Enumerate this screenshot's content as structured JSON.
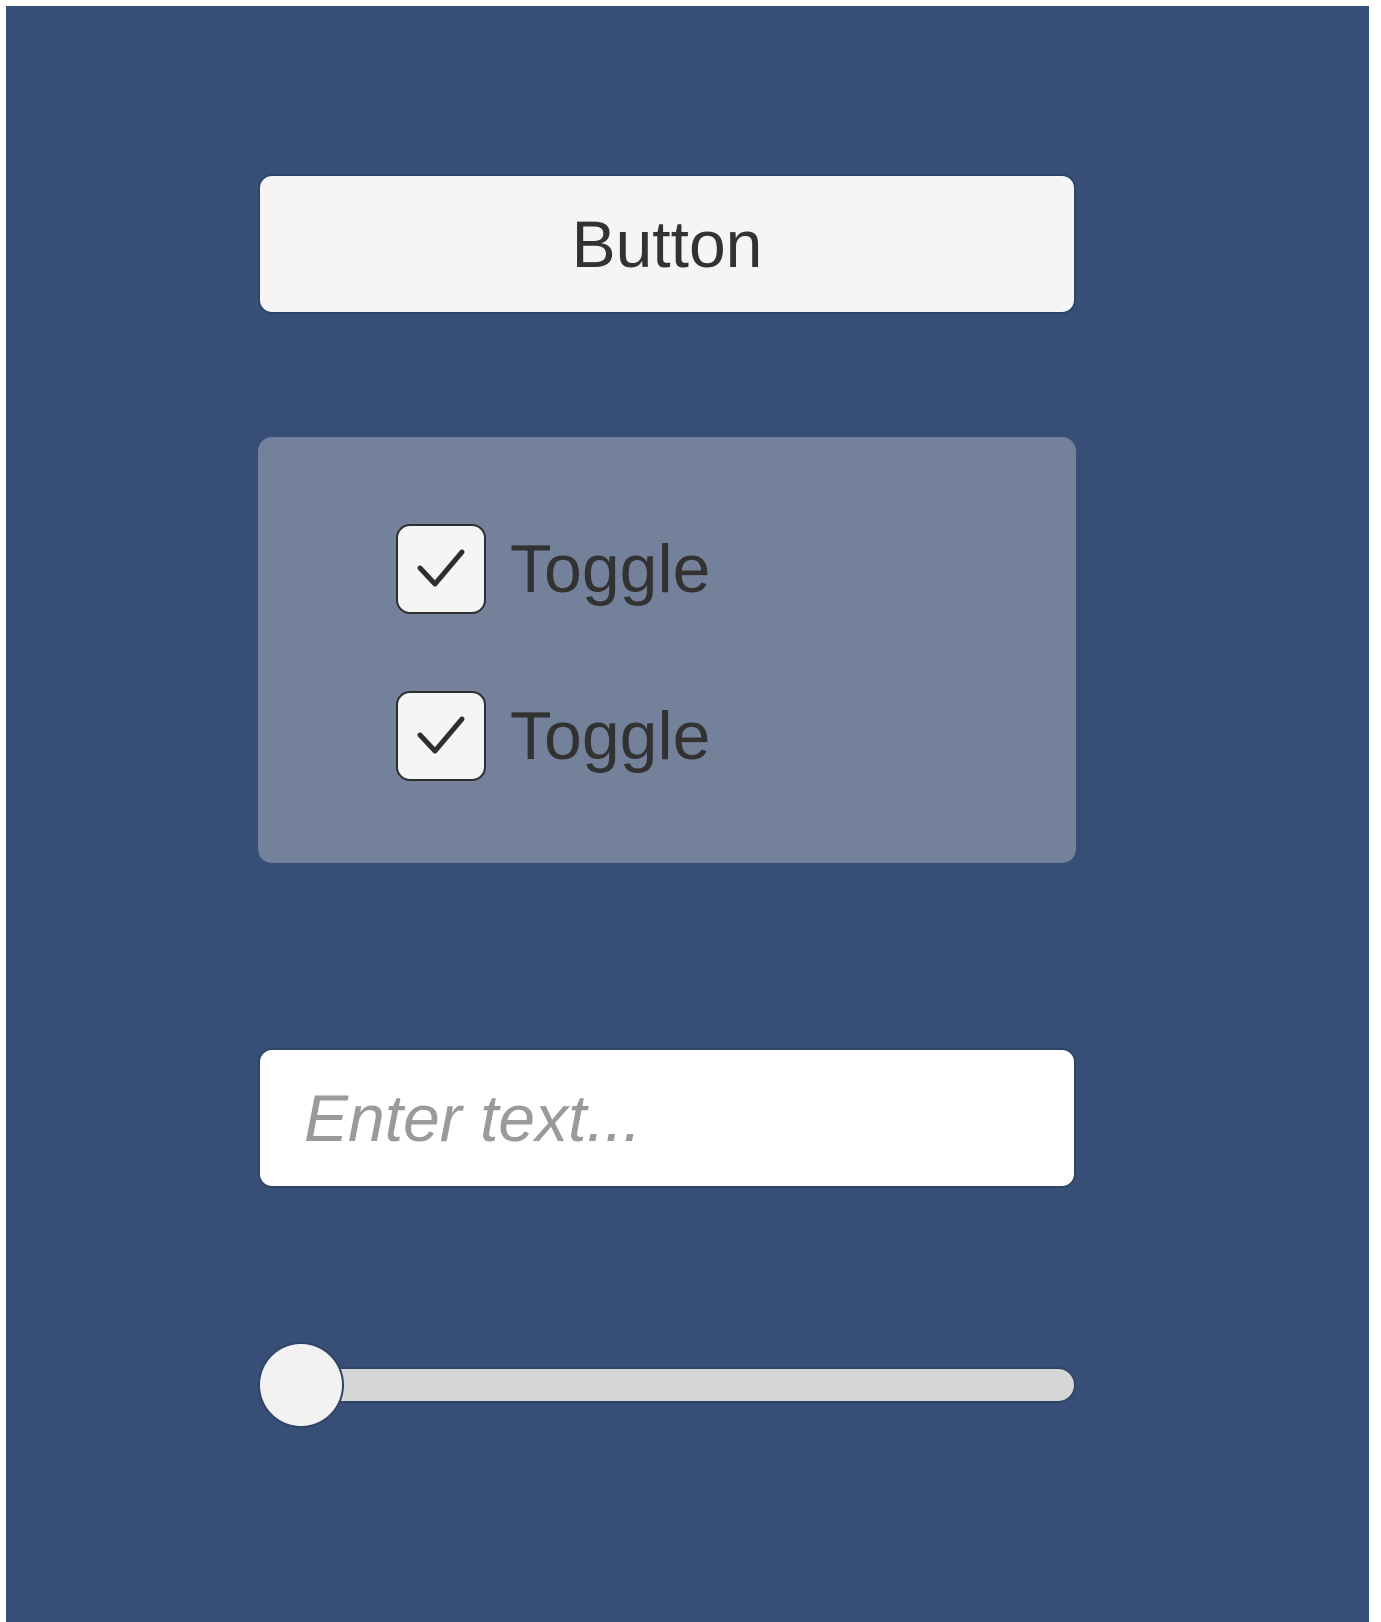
{
  "colors": {
    "background": "#374f76",
    "panel": "#74819a",
    "button": "#f5f5f5",
    "text": "#323232",
    "placeholder": "#9a9a9a",
    "slider_track": "#d6d6d6"
  },
  "button": {
    "label": "Button"
  },
  "toggles": [
    {
      "label": "Toggle",
      "checked": true,
      "icon": "checkmark-icon"
    },
    {
      "label": "Toggle",
      "checked": true,
      "icon": "checkmark-icon"
    }
  ],
  "input": {
    "placeholder": "Enter text...",
    "value": ""
  },
  "slider": {
    "value": 0.0,
    "min": 0.0,
    "max": 1.0
  }
}
